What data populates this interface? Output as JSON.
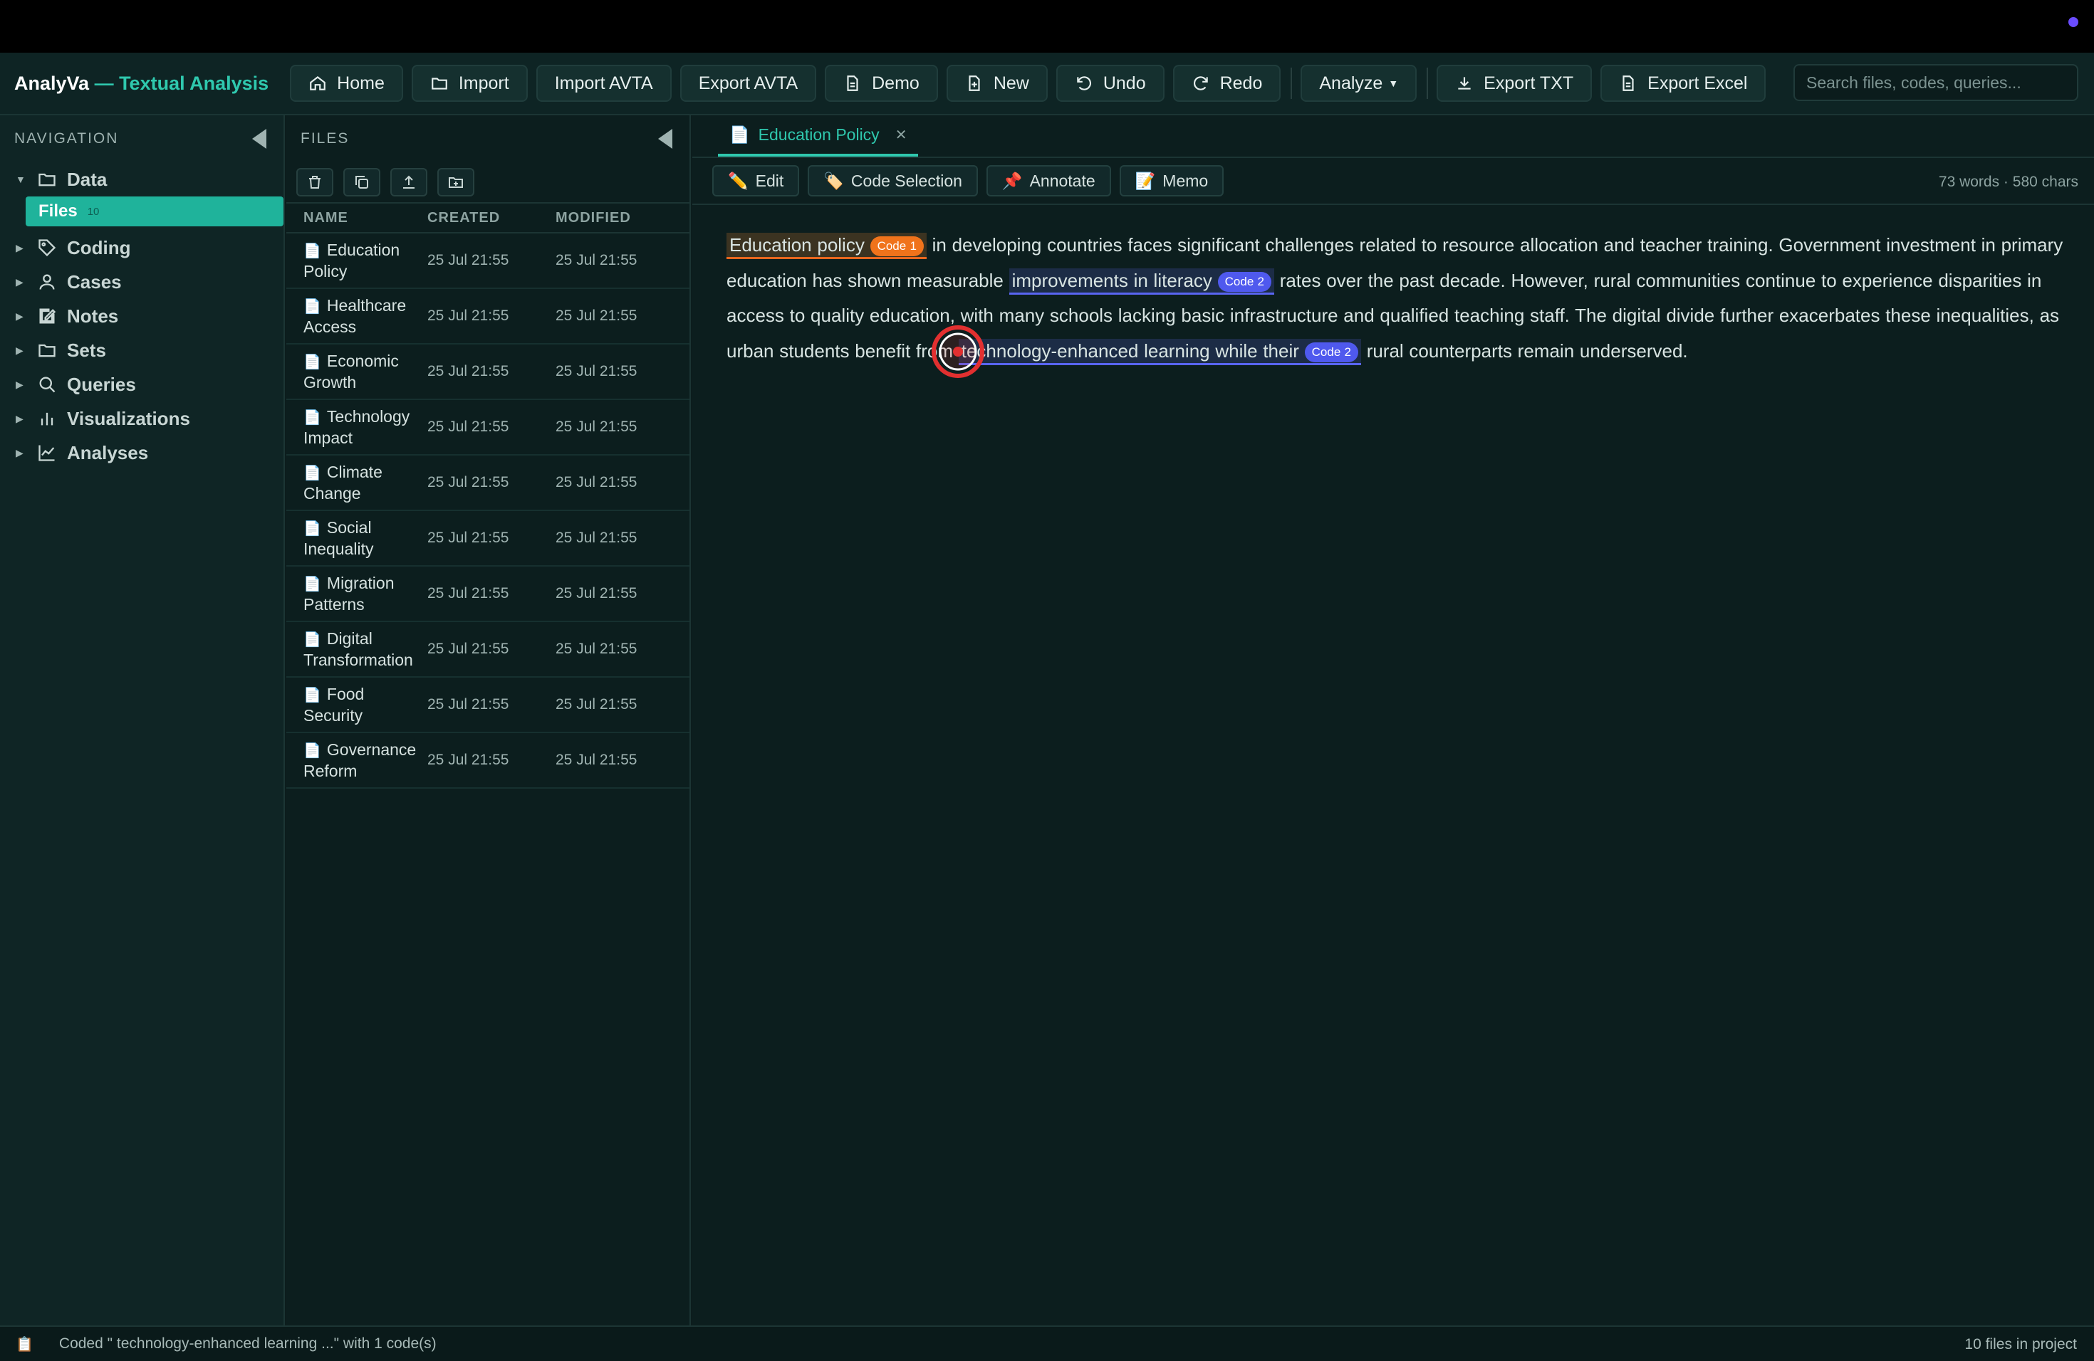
{
  "app": {
    "brand_main": "AnalyVa",
    "brand_tail": " — Textual Analysis"
  },
  "toolbar": {
    "home": "Home",
    "import": "Import",
    "import_avta": "Import AVTA",
    "export_avta": "Export AVTA",
    "demo": "Demo",
    "new": "New",
    "undo": "Undo",
    "redo": "Redo",
    "analyze": "Analyze",
    "export_txt": "Export TXT",
    "export_excel": "Export Excel",
    "search_placeholder": "Search files, codes, queries..."
  },
  "nav": {
    "title": "NAVIGATION",
    "items": [
      {
        "label": "Data",
        "icon": "folder-icon",
        "expanded": true
      },
      {
        "label": "Coding",
        "icon": "tag-icon"
      },
      {
        "label": "Cases",
        "icon": "user-icon"
      },
      {
        "label": "Notes",
        "icon": "edit-icon"
      },
      {
        "label": "Sets",
        "icon": "folder-icon"
      },
      {
        "label": "Queries",
        "icon": "search-icon"
      },
      {
        "label": "Visualizations",
        "icon": "bar-chart-icon"
      },
      {
        "label": "Analyses",
        "icon": "line-chart-icon"
      }
    ],
    "files_item": {
      "label": "Files",
      "count": "10"
    }
  },
  "files": {
    "title": "FILES",
    "columns": [
      "NAME",
      "CREATED",
      "MODIFIED"
    ],
    "rows": [
      {
        "l1": "Education",
        "l2": "Policy",
        "created": "25 Jul 21:55",
        "modified": "25 Jul 21:55"
      },
      {
        "l1": "Healthcare",
        "l2": "Access",
        "created": "25 Jul 21:55",
        "modified": "25 Jul 21:55"
      },
      {
        "l1": "Economic",
        "l2": "Growth",
        "created": "25 Jul 21:55",
        "modified": "25 Jul 21:55"
      },
      {
        "l1": "Technology",
        "l2": "Impact",
        "created": "25 Jul 21:55",
        "modified": "25 Jul 21:55"
      },
      {
        "l1": "Climate",
        "l2": "Change",
        "created": "25 Jul 21:55",
        "modified": "25 Jul 21:55"
      },
      {
        "l1": "Social",
        "l2": "Inequality",
        "created": "25 Jul 21:55",
        "modified": "25 Jul 21:55"
      },
      {
        "l1": "Migration",
        "l2": "Patterns",
        "created": "25 Jul 21:55",
        "modified": "25 Jul 21:55"
      },
      {
        "l1": "Digital",
        "l2": "Transformation",
        "created": "25 Jul 21:55",
        "modified": "25 Jul 21:55"
      },
      {
        "l1": "Food",
        "l2": "Security",
        "created": "25 Jul 21:55",
        "modified": "25 Jul 21:55"
      },
      {
        "l1": "Governance",
        "l2": "Reform",
        "created": "25 Jul 21:55",
        "modified": "25 Jul 21:55"
      }
    ]
  },
  "editor": {
    "tab_label": "Education Policy",
    "tools": {
      "edit": "Edit",
      "code_selection": "Code Selection",
      "annotate": "Annotate",
      "memo": "Memo"
    },
    "word_count": "73 words · 580 chars",
    "text": {
      "seg1_hl": "Education policy",
      "code1": "Code 1",
      "seg2": " in developing countries faces significant challenges related to resource allocation and teacher training. Government investment in primary education has shown measurable ",
      "seg3_hl": "improvements in literacy",
      "code2a": "Code 2",
      "seg4": " rates over the past decade. However, rural communities continue to experience disparities in access to quality education, with many schools lacking basic infrastructure and qualified teaching staff. The digital divide further exacerbates these inequalities, as urban students benefit from ",
      "seg5_hl": "technology-enhanced learning while their",
      "code2b": "Code 2",
      "seg6": " rural counterparts remain underserved."
    },
    "colors": {
      "code1": "#f0731b",
      "code2": "#4f59ee",
      "accent": "#2fc8ae"
    }
  },
  "status": {
    "message": "Coded \" technology-enhanced learning ...\" with 1 code(s)",
    "right": "10 files in project"
  }
}
